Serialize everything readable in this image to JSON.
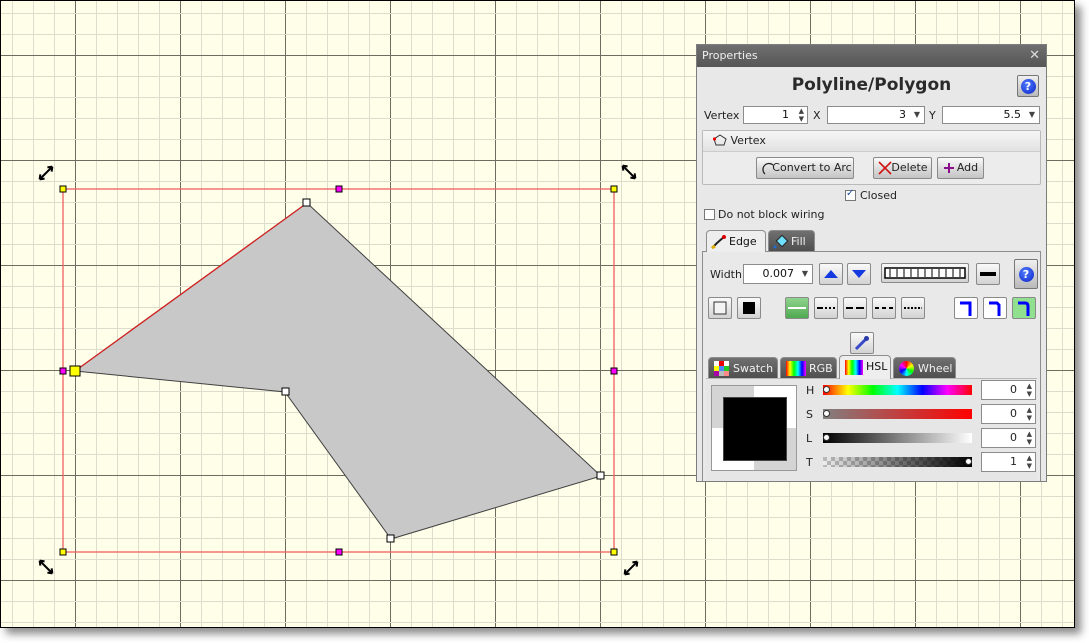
{
  "canvas": {
    "background": "#fefee9",
    "grid_minor_color": "#dedccd",
    "grid_major_color": "#6e6e60",
    "polygon_fill": "#c8c8c8",
    "polygon_stroke": "#404040",
    "selected_edge_color": "#d42020",
    "selection_box_color": "#f06060",
    "vertex_handle_fill": "#ffffff",
    "selected_vertex_fill": "#ffff00",
    "corner_handle_fill": "#ffff00",
    "midpoint_handle_fill": "#ff00ff",
    "icons": [
      "rotate-handle-icon"
    ]
  },
  "panel": {
    "title": "Properties",
    "close_glyph": "✕",
    "heading": "Polyline/Polygon",
    "help_glyph": "?",
    "vertex_label": "Vertex",
    "vertex_value": "1",
    "x_label": "X",
    "x_value": "3",
    "y_label": "Y",
    "y_value": "5.5",
    "vertex_group_title": "Vertex",
    "convert_to_arc": "Convert to Arc",
    "delete": "Delete",
    "add": "Add",
    "closed_label": "Closed",
    "closed_checked": true,
    "no_block_wiring_label": "Do not block wiring",
    "no_block_wiring_checked": false,
    "tabs": [
      {
        "label": "Edge",
        "active": true
      },
      {
        "label": "Fill",
        "active": false
      }
    ],
    "width_label": "Width",
    "width_value": "0.007",
    "color_tabs": [
      {
        "label": "Swatch",
        "active": false
      },
      {
        "label": "RGB",
        "active": false
      },
      {
        "label": "HSL",
        "active": true
      },
      {
        "label": "Wheel",
        "active": false
      }
    ],
    "hsl": [
      {
        "label": "H",
        "value": "0",
        "fraction": 0
      },
      {
        "label": "S",
        "value": "0",
        "fraction": 0
      },
      {
        "label": "L",
        "value": "0",
        "fraction": 0
      },
      {
        "label": "T",
        "value": "1",
        "fraction": 1
      }
    ],
    "preview_color": "#000000",
    "accent_green": "#90e090",
    "accent_blue": "#0000ff"
  }
}
